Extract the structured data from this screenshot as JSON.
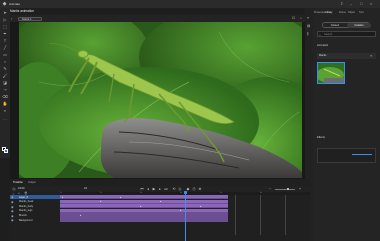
{
  "app": {
    "title": "Animate",
    "logo_icon": "app-logo-icon"
  },
  "document": {
    "tab_label": "Mantis animation"
  },
  "toolbar": {
    "scene_label": "Scene 1"
  },
  "tools": {
    "items": [
      "selection-tool",
      "subselection-tool",
      "free-transform-tool",
      "pen-tool",
      "text-tool",
      "line-tool",
      "rectangle-tool",
      "oval-tool",
      "pencil-tool",
      "brush-tool",
      "paint-bucket-tool",
      "eyedropper-tool",
      "eraser-tool",
      "hand-tool",
      "zoom-tool",
      "stroke-color",
      "fill-color"
    ]
  },
  "right_panel": {
    "tabs": [
      "Properties",
      "Library",
      "Frame",
      "Object",
      "Tool"
    ],
    "segment": {
      "left": "Default",
      "right": "Custom"
    },
    "search_placeholder": "Search",
    "section_1": "Animated",
    "section_2": "Effects",
    "item_label": "Mantis"
  },
  "timeline": {
    "tabs": [
      "Timeline",
      "Output"
    ],
    "frame_display": "24",
    "fps_display": "24.00",
    "ruler_ticks": [
      "1s",
      "2s",
      "3s",
      "4s",
      "5s",
      "6s"
    ],
    "layers": [
      {
        "name": "Layer_6"
      },
      {
        "name": "Mantis_head"
      },
      {
        "name": "Mantis_body"
      },
      {
        "name": "Mantis_legs"
      },
      {
        "name": "Branch"
      },
      {
        "name": "Background"
      }
    ],
    "selected_layer_index": 0
  },
  "colors": {
    "accent": "#3a8ff1",
    "track": "#8a67b8",
    "panel_bg": "#242424"
  }
}
